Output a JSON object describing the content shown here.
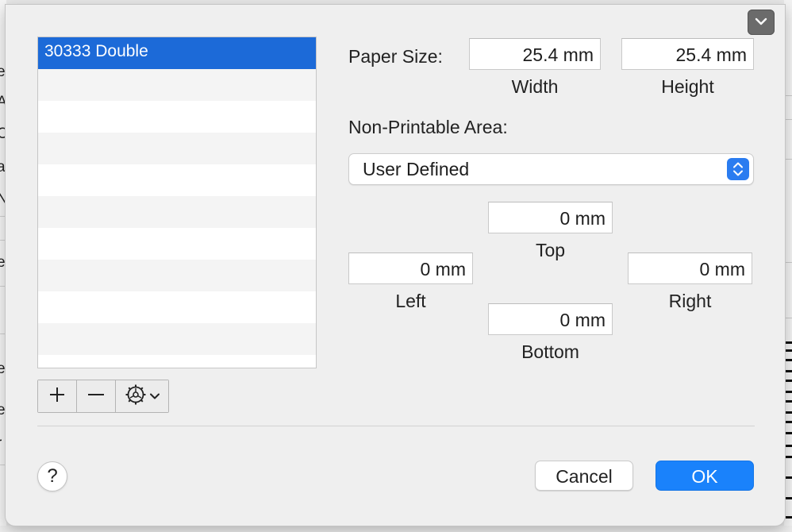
{
  "list": {
    "items": [
      "30333 Double"
    ],
    "selected_index": 0
  },
  "list_controls": {
    "add_icon": "plus-icon",
    "remove_icon": "minus-icon",
    "action_icon": "gear-icon"
  },
  "paper_size": {
    "label": "Paper Size:",
    "width_value": "25.4 mm",
    "width_caption": "Width",
    "height_value": "25.4 mm",
    "height_caption": "Height"
  },
  "non_printable": {
    "label": "Non-Printable Area:",
    "selected": "User Defined",
    "top_value": "0 mm",
    "top_caption": "Top",
    "left_value": "0 mm",
    "left_caption": "Left",
    "right_value": "0 mm",
    "right_caption": "Right",
    "bottom_value": "0 mm",
    "bottom_caption": "Bottom"
  },
  "footer": {
    "help_label": "?",
    "cancel_label": "Cancel",
    "ok_label": "OK"
  },
  "colors": {
    "accent": "#1a82fb",
    "selection": "#1c6ad8",
    "sheet_background": "#efefef"
  }
}
